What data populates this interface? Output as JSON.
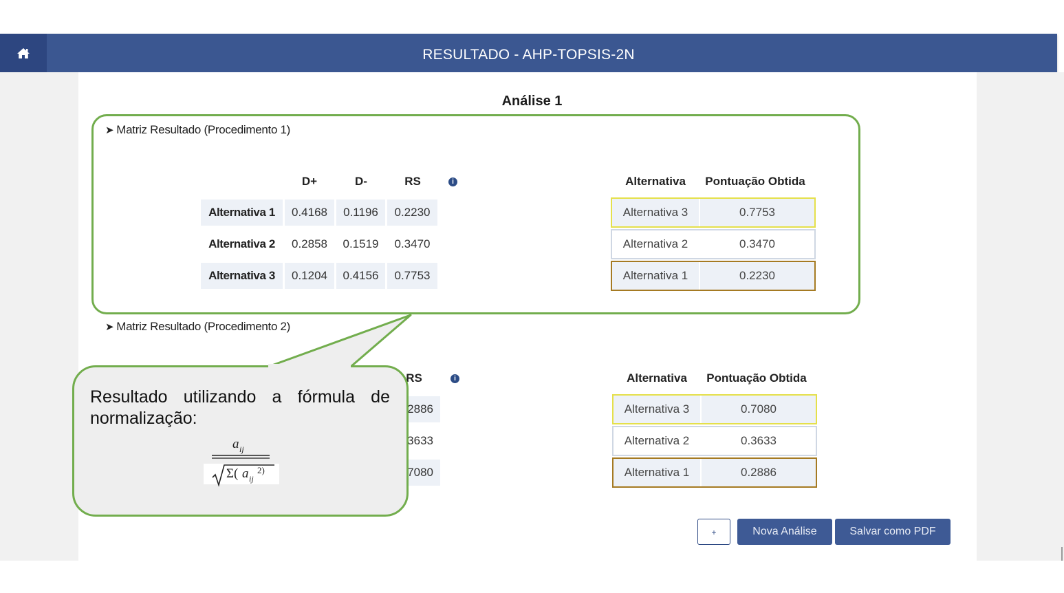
{
  "header": {
    "title": "RESULTADO - AHP-TOPSIS-2N",
    "home_icon": "home-icon"
  },
  "analysis": {
    "title": "Análise 1"
  },
  "procedure1": {
    "header": "Matriz Resultado (Procedimento 1)",
    "caret": "➤",
    "columns": [
      "D+",
      "D-",
      "RS"
    ],
    "rows": [
      {
        "label": "Alternativa 1",
        "d_plus": "0.4168",
        "d_minus": "0.1196",
        "rs": "0.2230"
      },
      {
        "label": "Alternativa 2",
        "d_plus": "0.2858",
        "d_minus": "0.1519",
        "rs": "0.3470"
      },
      {
        "label": "Alternativa 3",
        "d_plus": "0.1204",
        "d_minus": "0.4156",
        "rs": "0.7753"
      }
    ],
    "ranking_headers": {
      "alternative": "Alternativa",
      "score": "Pontuação Obtida"
    },
    "ranking": [
      {
        "alternative": "Alternativa 3",
        "score": "0.7753"
      },
      {
        "alternative": "Alternativa 2",
        "score": "0.3470"
      },
      {
        "alternative": "Alternativa 1",
        "score": "0.2230"
      }
    ]
  },
  "procedure2": {
    "header": "Matriz Resultado (Procedimento 2)",
    "caret": "➤",
    "visible_rs_header": "RS",
    "visible_rs_fragments": [
      "2886",
      "3633",
      "7080"
    ],
    "ranking_headers": {
      "alternative": "Alternativa",
      "score": "Pontuação Obtida"
    },
    "ranking": [
      {
        "alternative": "Alternativa 3",
        "score": "0.7080"
      },
      {
        "alternative": "Alternativa 2",
        "score": "0.3633"
      },
      {
        "alternative": "Alternativa 1",
        "score": "0.2886"
      }
    ]
  },
  "callout": {
    "text": "Resultado utilizando a fórmula de normalização:"
  },
  "buttons": {
    "plus": "+",
    "new_analysis": "Nova Análise",
    "save_pdf": "Salvar como PDF"
  },
  "colors": {
    "header_bg": "#3b5791",
    "highlight_green": "#72ad4d",
    "rank_first_border": "#e5e04a",
    "rank_last_border": "#a57a22",
    "button_primary": "#3e5a95"
  }
}
